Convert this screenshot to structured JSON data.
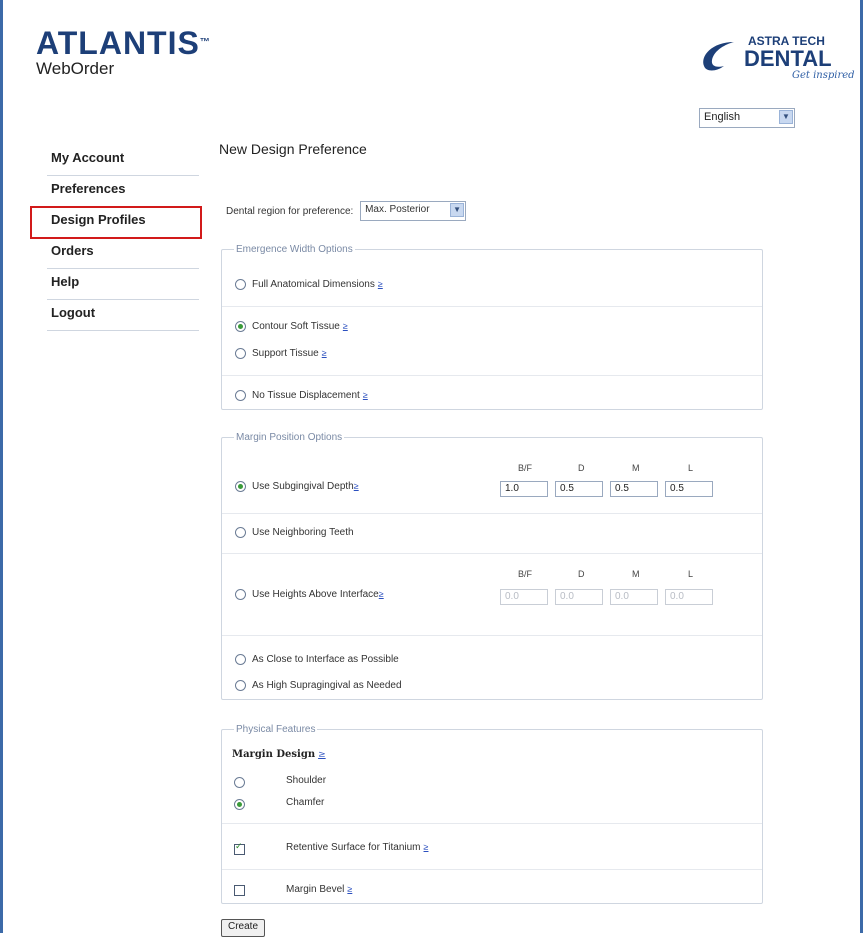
{
  "header": {
    "brand": "ATLANTIS",
    "trademark": "™",
    "product": "WebOrder",
    "partner_line1": "ASTRA TECH",
    "partner_line2": "DENTAL",
    "partner_tagline": "Get inspired",
    "brand_color": "#1d3f78"
  },
  "language": {
    "selected": "English"
  },
  "sidebar": {
    "items": [
      {
        "label": "My Account"
      },
      {
        "label": "Preferences"
      },
      {
        "label": "Design Profiles",
        "active": true
      },
      {
        "label": "Orders"
      },
      {
        "label": "Help"
      },
      {
        "label": "Logout"
      }
    ]
  },
  "main": {
    "title": "New Design Preference",
    "region": {
      "label": "Dental region for preference:",
      "selected": "Max. Posterior"
    },
    "emergence": {
      "legend": "Emergence Width Options",
      "options": [
        {
          "label": "Full Anatomical Dimensions",
          "checked": false
        },
        {
          "label": "Contour Soft Tissue",
          "checked": true
        },
        {
          "label": "Support Tissue",
          "checked": false
        },
        {
          "label": "No Tissue Displacement",
          "checked": false
        }
      ]
    },
    "margin": {
      "legend": "Margin Position Options",
      "columns": [
        "B/F",
        "D",
        "M",
        "L"
      ],
      "subgingival": {
        "label": "Use Subgingival Depth",
        "checked": true,
        "values": [
          "1.0",
          "0.5",
          "0.5",
          "0.5"
        ]
      },
      "neighboring": {
        "label": "Use Neighboring Teeth",
        "checked": false
      },
      "heights": {
        "label": "Use Heights Above Interface",
        "checked": false,
        "values": [
          "0.0",
          "0.0",
          "0.0",
          "0.0"
        ]
      },
      "close": {
        "label": "As Close to Interface as Possible",
        "checked": false
      },
      "high": {
        "label": "As High Supragingival as Needed",
        "checked": false
      }
    },
    "physical": {
      "legend": "Physical Features",
      "margin_design_label": "Margin Design",
      "shoulder": {
        "label": "Shoulder",
        "checked": false
      },
      "chamfer": {
        "label": "Chamfer",
        "checked": true
      },
      "retentive": {
        "label": "Retentive Surface for Titanium",
        "checked": true
      },
      "bevel": {
        "label": "Margin Bevel",
        "checked": false
      }
    },
    "help_glyph": "≥",
    "create_label": "Create"
  }
}
